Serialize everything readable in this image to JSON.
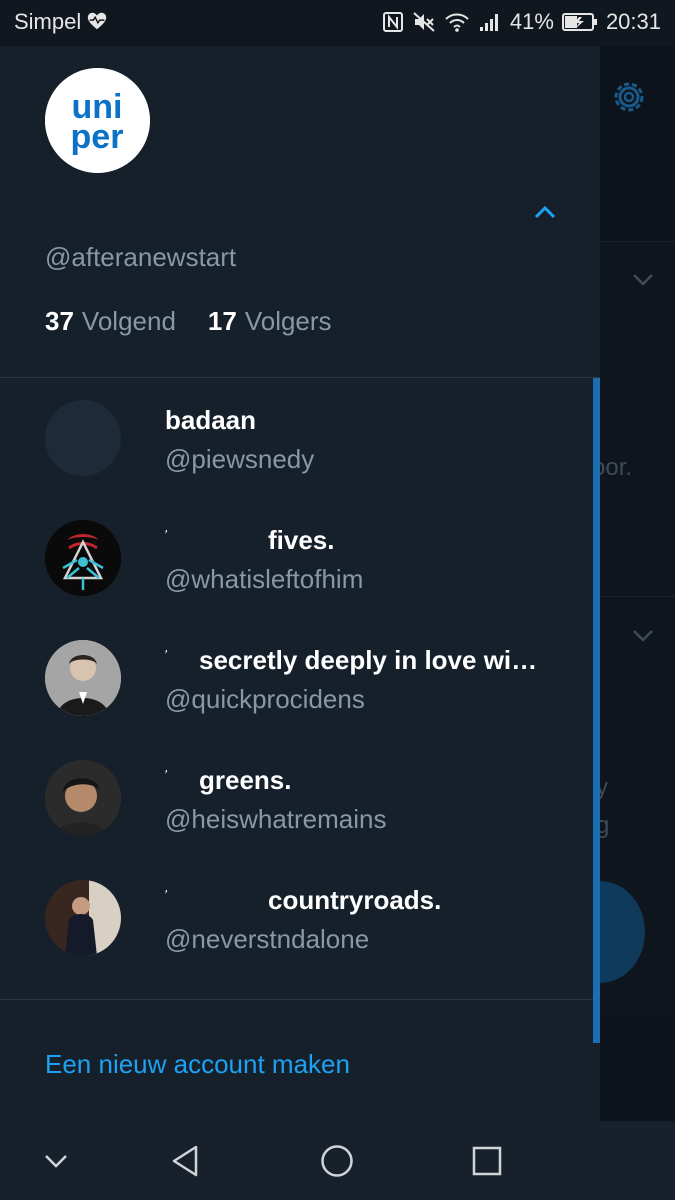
{
  "status_bar": {
    "carrier": "Simpel",
    "battery": "41%",
    "time": "20:31",
    "icons": [
      "heart-pulse-icon",
      "nfc-icon",
      "mute-icon",
      "wifi-icon",
      "signal-icon",
      "battery-icon"
    ]
  },
  "background": {
    "snippet_1": "oor.",
    "snippet_2": "y",
    "snippet_3": "g"
  },
  "drawer": {
    "handle": "@afteranewstart",
    "following_count": "37",
    "following_label": "Volgend",
    "followers_count": "17",
    "followers_label": "Volgers",
    "accounts": [
      {
        "name": "badaan",
        "handle": "@piewsnedy",
        "avatar": "blank-avatar"
      },
      {
        "name": "fives.",
        "handle": "@whatisleftofhim",
        "avatar": "emblem-avatar"
      },
      {
        "name": "secretly deeply in love wi…",
        "handle": "@quickprocidens",
        "avatar": "photo-avatar"
      },
      {
        "name": "greens.",
        "handle": "@heiswhatremains",
        "avatar": "photo-avatar"
      },
      {
        "name": "countryroads.",
        "handle": "@neverstndalone",
        "avatar": "photo-avatar"
      }
    ],
    "new_account_label": "Een nieuw account maken"
  },
  "nav_bar": {
    "buttons": [
      "chevron-down-icon",
      "back-icon",
      "home-icon",
      "recents-icon"
    ]
  },
  "colors": {
    "drawer_bg": "#15202b",
    "accent": "#1da1f2",
    "secondary_text": "#8899a6"
  }
}
